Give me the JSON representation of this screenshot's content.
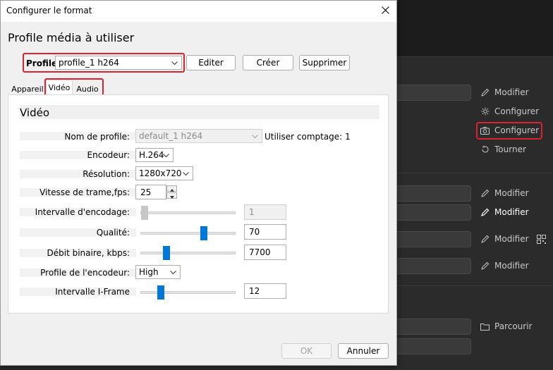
{
  "window": {
    "title": "Configurer le format",
    "close_icon": "close-icon"
  },
  "heading": "Profile média à utiliser",
  "profile": {
    "label": "Profile",
    "selected": "profile_1 h264",
    "buttons": {
      "edit": "Editer",
      "create": "Créer",
      "delete": "Supprimer"
    }
  },
  "tabs": [
    {
      "label": "Appareil",
      "active": false
    },
    {
      "label": "Vidéo",
      "active": true
    },
    {
      "label": "Audio",
      "active": false
    }
  ],
  "video": {
    "title": "Vidéo",
    "profile_name": {
      "label": "Nom de profile:",
      "value": "default_1 h264",
      "usage_label": "Utiliser comptage:",
      "usage_count": "1"
    },
    "encoder": {
      "label": "Encodeur:",
      "value": "H.264"
    },
    "resolution": {
      "label": "Résolution:",
      "value": "1280x720"
    },
    "framerate": {
      "label": "Vitesse de trame,fps:",
      "value": "25"
    },
    "encode_interval": {
      "label": "Intervalle d'encodage:",
      "value": "1",
      "slider_fraction": 0.0
    },
    "quality": {
      "label": "Qualité:",
      "value": "70",
      "slider_fraction": 0.68
    },
    "bitrate": {
      "label": "Débit binaire, kbps:",
      "value": "7700",
      "slider_fraction": 0.25
    },
    "encoder_profile": {
      "label": "Profile de l'encodeur:",
      "value": "High"
    },
    "iframe_interval": {
      "label": "Intervalle I-Frame",
      "value": "12",
      "slider_fraction": 0.19
    }
  },
  "footer": {
    "ok": "OK",
    "cancel": "Annuler"
  },
  "background_app": {
    "actions": [
      {
        "label": "Modifier",
        "icon": "pencil-icon"
      },
      {
        "label": "Configurer",
        "icon": "gear-icon"
      },
      {
        "label": "Configurer",
        "icon": "camera-icon"
      },
      {
        "label": "Tourner",
        "icon": "rotate-icon"
      },
      {
        "label": "Modifier",
        "icon": "pencil-icon"
      },
      {
        "label": "Modifier",
        "icon": "pencil-icon"
      },
      {
        "label": "Modifier",
        "icon": "pencil-icon"
      },
      {
        "label": "Modifier",
        "icon": "pencil-icon"
      },
      {
        "label": "Parcourir",
        "icon": "folder-icon"
      }
    ]
  },
  "colors": {
    "accent": "#0078d7",
    "highlight": "#d9232e",
    "dark_bg": "#2b2b2b"
  }
}
